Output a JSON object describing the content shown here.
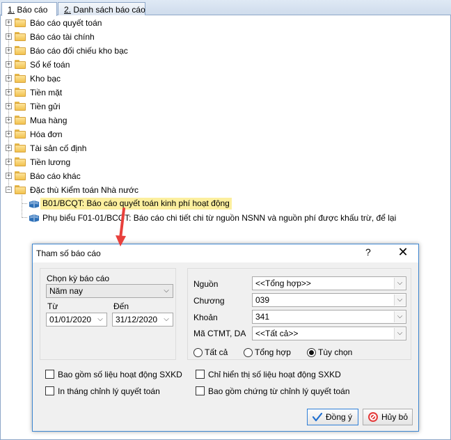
{
  "tabs": [
    {
      "num": "1.",
      "label": " Báo cáo"
    },
    {
      "num": "2.",
      "label": " Danh sách báo cáo"
    }
  ],
  "tree": {
    "folders": [
      "Báo cáo quyết toán",
      "Báo cáo tài chính",
      "Báo cáo đối chiếu kho bạc",
      "Sổ kế toán",
      "Kho bạc",
      "Tiền mặt",
      "Tiền gửi",
      "Mua hàng",
      "Hóa đơn",
      "Tài sản cố định",
      "Tiền lương",
      "Báo cáo khác",
      "Đặc thù Kiểm toán Nhà nước"
    ],
    "leaves": [
      "B01/BCQT: Báo cáo quyết toán kinh phí hoạt động",
      "Phụ biểu F01-01/BCQT: Báo cáo chi tiết chi từ nguồn NSNN và nguồn phí được khấu trừ, để lại"
    ]
  },
  "dialog": {
    "title": "Tham số báo cáo",
    "help": "?",
    "close": "✕",
    "period_label": "Chọn kỳ báo cáo",
    "period_value": "Năm nay",
    "from_label": "Từ",
    "from_value": "01/01/2020",
    "to_label": "Đến",
    "to_value": "31/12/2020",
    "fields": [
      {
        "label": "Nguồn",
        "value": "<<Tổng hợp>>"
      },
      {
        "label": "Chương",
        "value": "039"
      },
      {
        "label": "Khoản",
        "value": "341"
      },
      {
        "label": "Mã CTMT, DA",
        "value": "<<Tất cả>>"
      }
    ],
    "radios": [
      {
        "label": "Tất cả",
        "checked": false
      },
      {
        "label": "Tổng hợp",
        "checked": false
      },
      {
        "label": "Tùy chọn",
        "checked": true
      }
    ],
    "checks": [
      {
        "label": "Bao gồm số liệu hoạt động SXKD",
        "checked": false
      },
      {
        "label": "In tháng chỉnh lý quyết toán",
        "checked": false
      },
      {
        "label": "Chỉ hiển thị số liệu hoạt động SXKD",
        "checked": false
      },
      {
        "label": "Bao gồm chứng từ chỉnh lý quyết toán",
        "checked": false
      }
    ],
    "ok_label": "Đồng ý",
    "cancel_label": "Hủy bỏ"
  },
  "colors": {
    "accent": "#3d86d1",
    "highlight": "#fcef9e",
    "arrow": "#e8403c"
  }
}
